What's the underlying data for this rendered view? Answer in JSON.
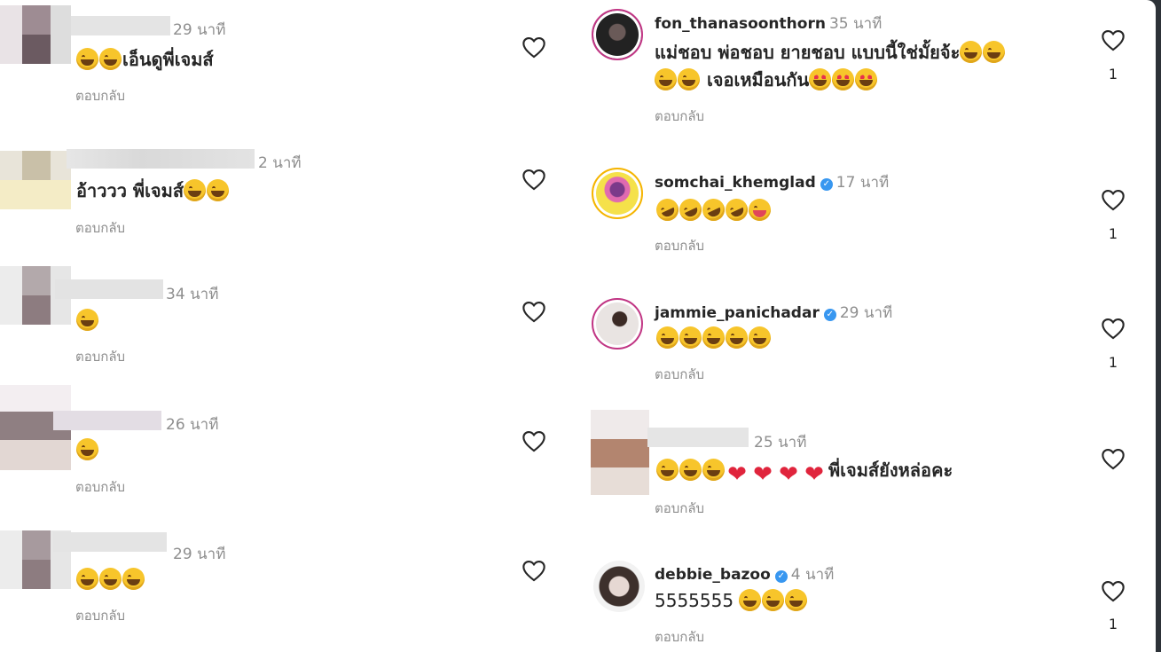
{
  "left_comments": [
    {
      "time": "29 นาที",
      "text": "เอ็นดูพี่เจมส์",
      "emoji_before": 2,
      "reply": "ตอบกลับ"
    },
    {
      "time": "2 นาที",
      "text": "อ้าววว พี่เจมส์",
      "emoji_after": 2,
      "reply": "ตอบกลับ"
    },
    {
      "time": "34 นาที",
      "emoji_count": 1,
      "reply": "ตอบกลับ"
    },
    {
      "time": "26 นาที",
      "emoji_count": 1,
      "reply": "ตอบกลับ"
    },
    {
      "time": "29 นาที",
      "emoji_count": 3,
      "reply": "ตอบกลับ"
    }
  ],
  "right_comments": [
    {
      "username": "fon_thanasoonthorn",
      "verified": false,
      "time": "35 นาที",
      "line1": "แม่ชอบ พ่อชอบ ยายชอบ แบบนี้ใช่มั้ยจ้ะ",
      "line2": "เจอเหมือนกัน",
      "reply": "ตอบกลับ",
      "likes": "1"
    },
    {
      "username": "somchai_khemglad",
      "verified": true,
      "time": "17 นาที",
      "reply": "ตอบกลับ",
      "likes": "1"
    },
    {
      "username": "jammie_panichadar",
      "verified": true,
      "time": "29 นาที",
      "reply": "ตอบกลับ",
      "likes": "1"
    },
    {
      "time": "25 นาที",
      "text": "พี่เจมส์ยังหล่อคะ",
      "reply": "ตอบกลับ"
    },
    {
      "username": "debbie_bazoo",
      "verified": true,
      "time": "4 นาที",
      "text": "5555555",
      "reply": "ตอบกลับ",
      "likes": "1"
    }
  ],
  "icons": {
    "like": "heart-outline-icon",
    "verified": "verified-badge-icon",
    "laugh": "joy-emoji",
    "rofl": "rofl-emoji",
    "tongue": "tongue-emoji",
    "heart_eyes": "heart-eyes-emoji",
    "red_heart": "red-heart-emoji"
  },
  "colors": {
    "text": "#262626",
    "muted": "#8e8e8e",
    "verified": "#3897f0",
    "story_ring": "#c13584",
    "background_frame": "#2d3238"
  }
}
